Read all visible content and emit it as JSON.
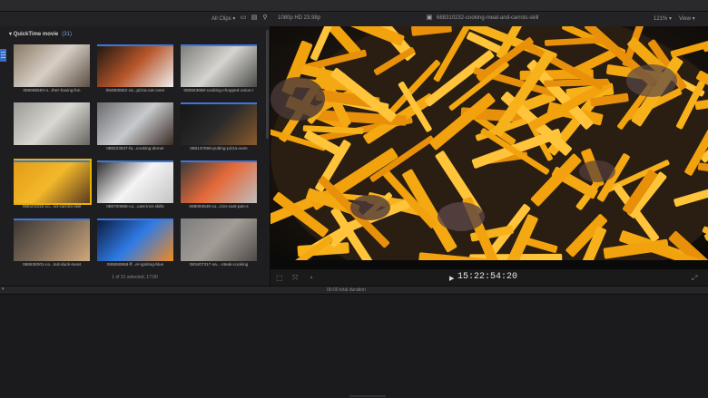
{
  "toolbar": {
    "clips_filter": "All Clips ▾",
    "format": "1080p HD 23.98p",
    "clip_title": "688310232-cooking-meat-and-carrots-skill",
    "zoom": "121% ▾",
    "view": "View ▾"
  },
  "library": {
    "title": "QuickTime movie",
    "count": "(31)",
    "status": "1 of 31 selected, 17:00"
  },
  "clips": [
    {
      "caption": "086688563-o...ther-having-fun",
      "colors": [
        "#8a7a66",
        "#d7cfc6",
        "#5c4e42"
      ],
      "blue": false,
      "selected": false
    },
    {
      "caption": "084800822-ca...pizza-out-oven",
      "colors": [
        "#1a1612",
        "#b7562a",
        "#efefef"
      ],
      "blue": true,
      "selected": false
    },
    {
      "caption": "080663668-cooking-chopped-onion-r",
      "colors": [
        "#7c7c78",
        "#d5d4cf",
        "#4a4a47"
      ],
      "blue": true,
      "selected": false
    },
    {
      "caption": "",
      "colors": [
        "#9a9994",
        "#d9d8d2",
        "#666560"
      ],
      "blue": false,
      "selected": false
    },
    {
      "caption": "088223837-fa...cooking-dinner",
      "colors": [
        "#6a6b6f",
        "#c7c9cc",
        "#3a2c26"
      ],
      "blue": false,
      "selected": false
    },
    {
      "caption": "088137869-putting-pizza-oven",
      "colors": [
        "#151515",
        "#2a2a2a",
        "#8a5a2b"
      ],
      "blue": true,
      "selected": false
    },
    {
      "caption": "088101032-co...nd-carrots-skill",
      "colors": [
        "#e29a16",
        "#f3b82a",
        "#5a3a20"
      ],
      "blue": true,
      "selected": true
    },
    {
      "caption": "088700868-co...cast-iron-skills",
      "colors": [
        "#2a2a2a",
        "#f4f4f4",
        "#c4c4c4"
      ],
      "blue": true,
      "selected": false
    },
    {
      "caption": "088093649-co...iron-cast-pan-s",
      "colors": [
        "#3a3a3a",
        "#e56a3a",
        "#bdbdbd"
      ],
      "blue": true,
      "selected": false
    },
    {
      "caption": "088638301-co...ted-duck-meat",
      "colors": [
        "#3a3631",
        "#7c6a58",
        "#cfa87a"
      ],
      "blue": true,
      "selected": false
    },
    {
      "caption": "088650868-ff...er-igniting-blue",
      "colors": [
        "#0b1a3a",
        "#2f7ae5",
        "#f08a20"
      ],
      "blue": true,
      "selected": false
    },
    {
      "caption": "083407317-sa...-steak-cooking",
      "colors": [
        "#7c7d80",
        "#a39c96",
        "#4e4a47"
      ],
      "blue": false,
      "selected": false
    },
    {
      "caption": "",
      "colors": [
        "#6f7fa8",
        "#cfd9ef",
        "#40506f"
      ],
      "blue": true,
      "selected": false
    },
    {
      "caption": "",
      "colors": [
        "#b6a98e",
        "#e7e1d3",
        "#3a352c"
      ],
      "blue": true,
      "selected": false
    },
    {
      "caption": "",
      "colors": [
        "#a86a2c",
        "#e39a4a",
        "#3a2410"
      ],
      "blue": false,
      "selected": false
    }
  ],
  "viewer": {
    "timecode": "15:22:54:20",
    "play_icon": "▶"
  },
  "timeline": {
    "duration": "00:00 total duration"
  }
}
